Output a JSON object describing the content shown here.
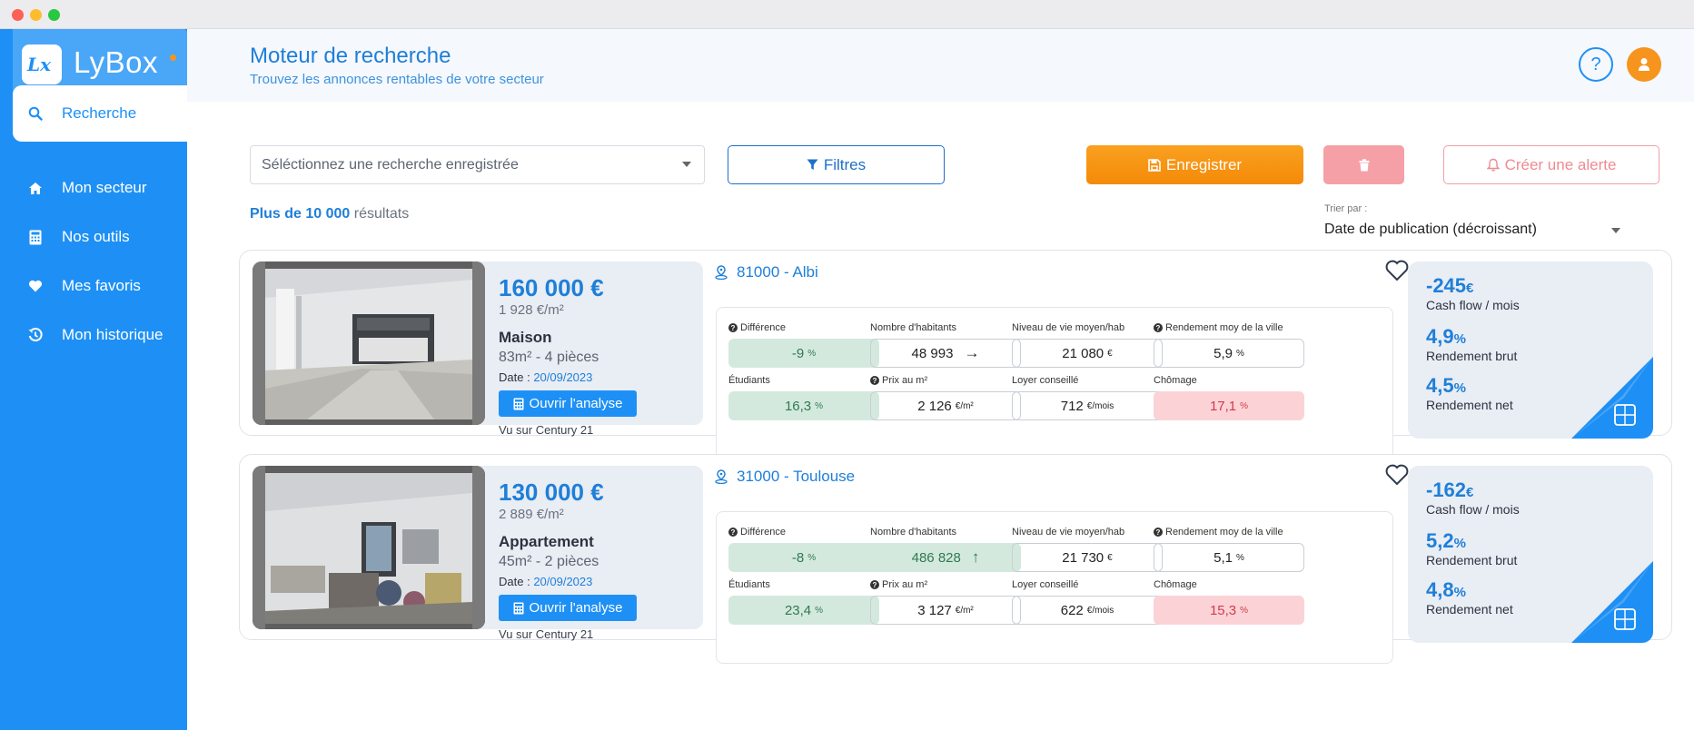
{
  "app": {
    "name": "LyBox",
    "logo_mark": "Lx"
  },
  "sidebar": {
    "items": [
      {
        "label": "Recherche",
        "icon": "search-icon",
        "active": true
      },
      {
        "label": "Mon secteur",
        "icon": "home-icon",
        "active": false
      },
      {
        "label": "Nos outils",
        "icon": "calculator-icon",
        "active": false
      },
      {
        "label": "Mes favoris",
        "icon": "heart-icon",
        "active": false
      },
      {
        "label": "Mon historique",
        "icon": "history-icon",
        "active": false
      }
    ]
  },
  "header": {
    "title": "Moteur de recherche",
    "subtitle": "Trouvez les annonces rentables de votre secteur",
    "help_label": "?"
  },
  "toolbar": {
    "saved_search_placeholder": "Séléctionnez une recherche enregistrée",
    "filters_label": "Filtres",
    "save_label": "Enregistrer",
    "alert_label": "Créer une alerte"
  },
  "results": {
    "prefix": "Plus de 10 000",
    "suffix": "résultats"
  },
  "sort": {
    "label": "Trier par :",
    "value": "Date de publication (décroissant)"
  },
  "stat_labels": {
    "difference": "Différence",
    "habitants": "Nombre d'habitants",
    "niveau_vie": "Niveau de vie moyen/hab",
    "rendement_ville": "Rendement moy de la ville",
    "etudiants": "Étudiants",
    "prix_m2": "Prix au m²",
    "loyer": "Loyer conseillé",
    "chomage": "Chômage"
  },
  "listings": [
    {
      "price": "160 000 €",
      "price_per_m2": "1 928 €/m²",
      "type": "Maison",
      "surface": "83m² - 4 pièces",
      "date_label": "Date :",
      "date": "20/09/2023",
      "open_label": "Ouvrir l'analyse",
      "seen_on": "Vu sur Century 21",
      "location": "81000 - Albi",
      "difference": "-9",
      "difference_unit": "%",
      "habitants": "48 993",
      "habitants_trend": "→",
      "niveau_vie": "21 080",
      "niveau_vie_unit": "€",
      "rendement_ville": "5,9",
      "rendement_ville_unit": "%",
      "etudiants": "16,3",
      "etudiants_unit": "%",
      "prix_m2": "2 126",
      "prix_m2_unit": "€/m²",
      "loyer": "712",
      "loyer_unit": "€/mois",
      "chomage": "17,1",
      "chomage_unit": "%",
      "cashflow": "-245",
      "cashflow_unit": "€",
      "cashflow_label": "Cash flow / mois",
      "rend_brut": "4,9",
      "rend_brut_unit": "%",
      "rend_brut_label": "Rendement brut",
      "rend_net": "4,5",
      "rend_net_unit": "%",
      "rend_net_label": "Rendement net"
    },
    {
      "price": "130 000 €",
      "price_per_m2": "2 889 €/m²",
      "type": "Appartement",
      "surface": "45m² - 2 pièces",
      "date_label": "Date :",
      "date": "20/09/2023",
      "open_label": "Ouvrir l'analyse",
      "seen_on": "Vu sur Century 21",
      "location": "31000 - Toulouse",
      "difference": "-8",
      "difference_unit": "%",
      "habitants": "486 828",
      "habitants_trend": "↑",
      "niveau_vie": "21 730",
      "niveau_vie_unit": "€",
      "rendement_ville": "5,1",
      "rendement_ville_unit": "%",
      "etudiants": "23,4",
      "etudiants_unit": "%",
      "prix_m2": "3 127",
      "prix_m2_unit": "€/m²",
      "loyer": "622",
      "loyer_unit": "€/mois",
      "chomage": "15,3",
      "chomage_unit": "%",
      "cashflow": "-162",
      "cashflow_unit": "€",
      "cashflow_label": "Cash flow / mois",
      "rend_brut": "5,2",
      "rend_brut_unit": "%",
      "rend_brut_label": "Rendement brut",
      "rend_net": "4,8",
      "rend_net_unit": "%",
      "rend_net_label": "Rendement net"
    }
  ],
  "colors": {
    "brand_blue": "#1e90f5",
    "accent_orange": "#f7941d",
    "positive_green": "#d4e9dd",
    "negative_red": "#fbd3d7"
  }
}
